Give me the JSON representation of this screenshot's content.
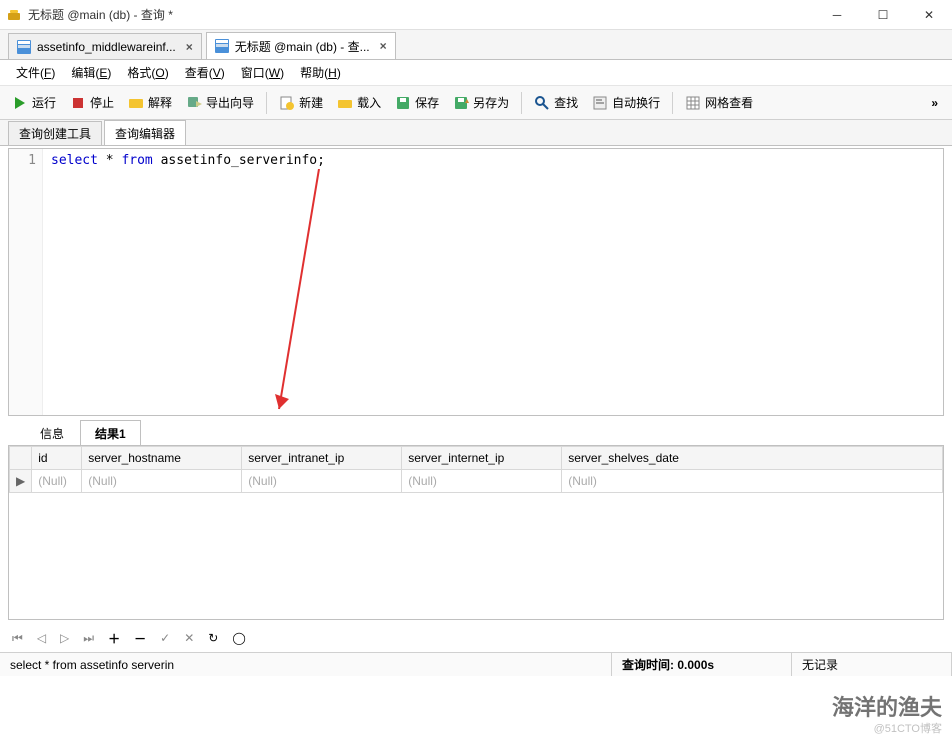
{
  "window": {
    "title": "无标题 @main (db) - 查询 *"
  },
  "tabs": [
    {
      "label": "assetinfo_middlewareinf...",
      "active": false
    },
    {
      "label": "无标题 @main (db) - 查...",
      "active": true
    }
  ],
  "menubar": [
    {
      "label": "文件",
      "key": "F"
    },
    {
      "label": "编辑",
      "key": "E"
    },
    {
      "label": "格式",
      "key": "O"
    },
    {
      "label": "查看",
      "key": "V"
    },
    {
      "label": "窗口",
      "key": "W"
    },
    {
      "label": "帮助",
      "key": "H"
    }
  ],
  "toolbar": {
    "run": "运行",
    "stop": "停止",
    "explain": "解释",
    "export_wizard": "导出向导",
    "new": "新建",
    "load": "载入",
    "save": "保存",
    "save_as": "另存为",
    "find": "查找",
    "auto_wrap": "自动换行",
    "grid_view": "网格查看"
  },
  "editor_tabs": {
    "builder": "查询创建工具",
    "editor": "查询编辑器"
  },
  "sql": {
    "line": "1",
    "text": "select * from assetinfo_serverinfo;",
    "kw_select": "select",
    "kw_from": "from",
    "rest1": " * ",
    "rest2": " assetinfo_serverinfo;"
  },
  "result_tabs": {
    "info": "信息",
    "result1": "结果1"
  },
  "columns": [
    "id",
    "server_hostname",
    "server_intranet_ip",
    "server_internet_ip",
    "server_shelves_date"
  ],
  "row": [
    "(Null)",
    "(Null)",
    "(Null)",
    "(Null)",
    "(Null)"
  ],
  "status": {
    "sql": "select * from assetinfo serverin",
    "time_label": "查询时间:",
    "time_value": "0.000s",
    "records": "无记录"
  },
  "watermark": "海洋的渔夫",
  "watermark2": "@51CTO博客"
}
